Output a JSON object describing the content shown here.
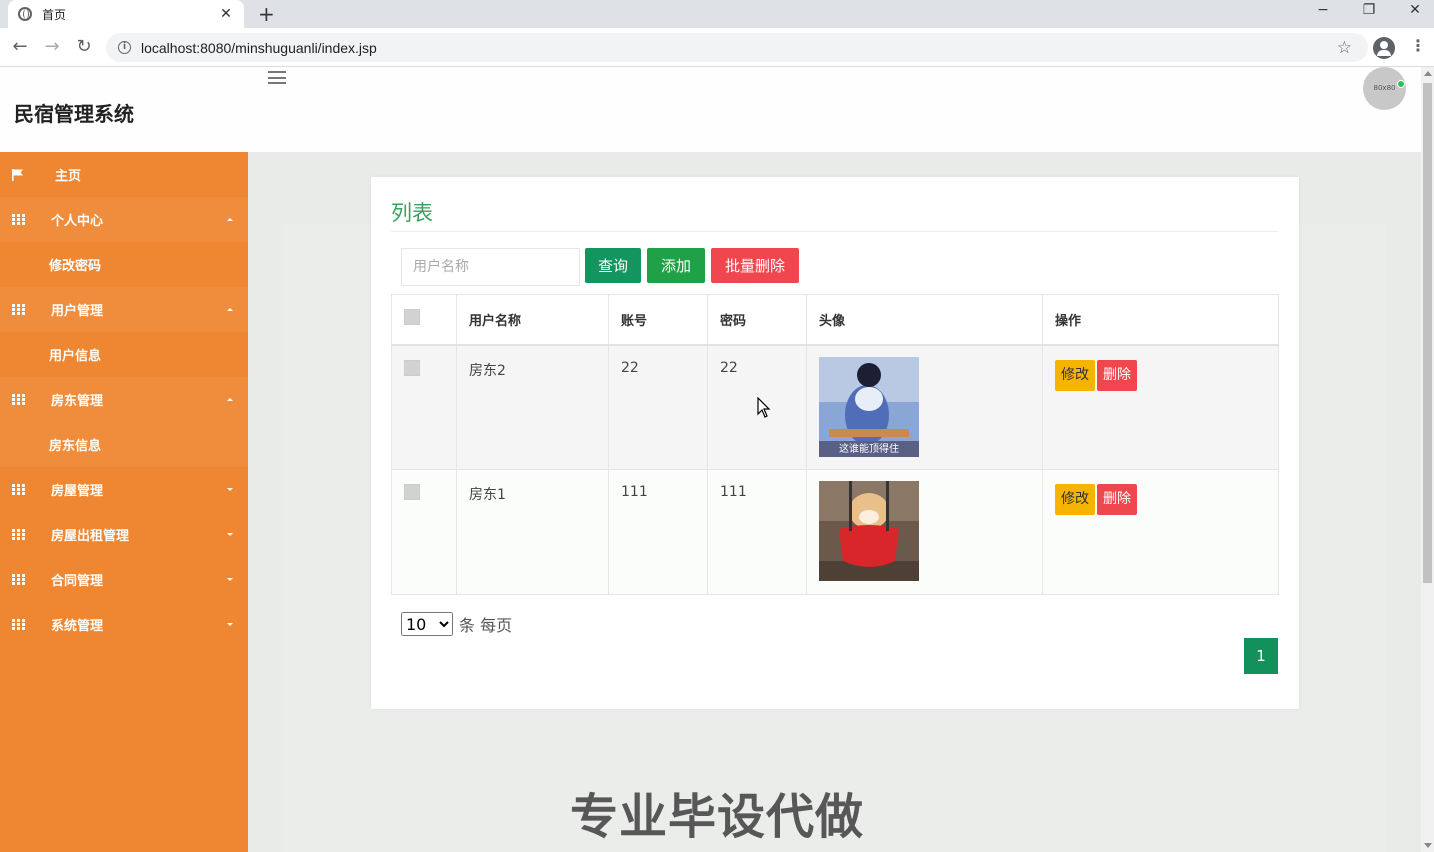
{
  "browser": {
    "tab_title": "首页",
    "url": "localhost:8080/minshuguanli/index.jsp",
    "minimize": "−",
    "restore": "❐",
    "close": "✕",
    "new_tab": "+",
    "tab_close": "✕"
  },
  "header": {
    "site_title": "民宿管理系统",
    "avatar_text": "80x80"
  },
  "sidebar": {
    "home": "主页",
    "personal_center": "个人中心",
    "change_password": "修改密码",
    "user_mgmt": "用户管理",
    "user_info": "用户信息",
    "landlord_mgmt": "房东管理",
    "landlord_info": "房东信息",
    "house_mgmt": "房屋管理",
    "rent_mgmt": "房屋出租管理",
    "contract_mgmt": "合同管理",
    "system_mgmt": "系统管理"
  },
  "main": {
    "title": "列表",
    "search_placeholder": "用户名称",
    "query_label": "查询",
    "add_label": "添加",
    "batch_delete_label": "批量删除",
    "columns": [
      "用户名称",
      "账号",
      "密码",
      "头像",
      "操作"
    ],
    "rows": [
      {
        "name": "房东2",
        "account": "22",
        "password": "22",
        "avatar_caption": "这谁能顶得住"
      },
      {
        "name": "房东1",
        "account": "111",
        "password": "111",
        "avatar_caption": ""
      }
    ],
    "edit_label": "修改",
    "delete_label": "删除",
    "page_size": "10",
    "page_size_suffix": "条 每页",
    "current_page": "1"
  },
  "watermark": "专业毕设代做",
  "colors": {
    "sidebar": "#ee8632",
    "title_green": "#3aa060",
    "query": "#14945e",
    "add": "#20a047",
    "danger": "#f0474f",
    "edit": "#f6b300"
  }
}
